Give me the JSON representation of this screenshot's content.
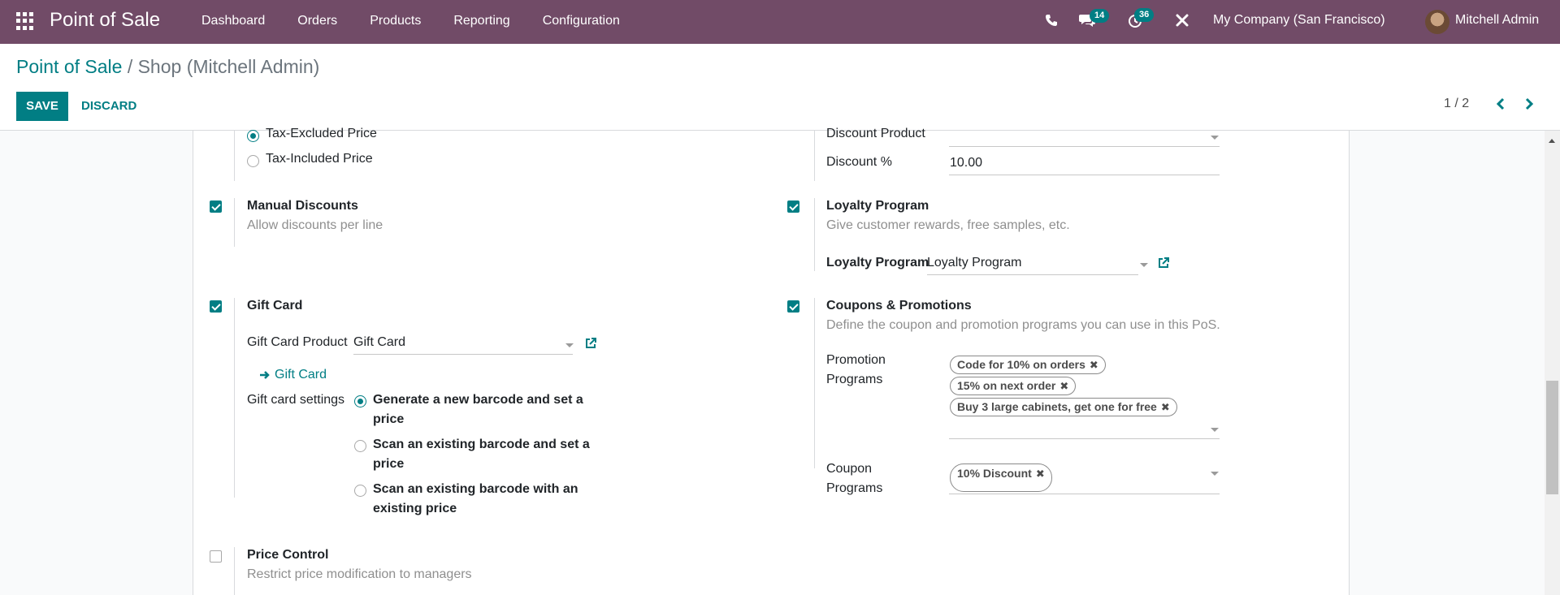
{
  "navbar": {
    "brand": "Point of Sale",
    "menu": [
      "Dashboard",
      "Orders",
      "Products",
      "Reporting",
      "Configuration"
    ],
    "messages_badge": "14",
    "activities_badge": "36",
    "company": "My Company (San Francisco)",
    "user": "Mitchell Admin"
  },
  "control": {
    "breadcrumb_root": "Point of Sale",
    "breadcrumb_sep": "/",
    "breadcrumb_current": "Shop (Mitchell Admin)",
    "save": "SAVE",
    "discard": "DISCARD",
    "pager": "1 / 2"
  },
  "left": {
    "tax_excluded": "Tax-Excluded Price",
    "tax_included": "Tax-Included Price",
    "manual_discounts": {
      "title": "Manual Discounts",
      "desc": "Allow discounts per line",
      "checked": true
    },
    "gift_card": {
      "title": "Gift Card",
      "checked": true,
      "product_label": "Gift Card Product",
      "product_value": "Gift Card",
      "link": "Gift Card",
      "settings_label": "Gift card settings",
      "options": [
        {
          "line1": "Generate a new barcode and set a",
          "line2": "price",
          "checked": true
        },
        {
          "line1": "Scan an existing barcode and set a",
          "line2": "price",
          "checked": false
        },
        {
          "line1": "Scan an existing barcode with an",
          "line2": "existing price",
          "checked": false
        }
      ]
    },
    "price_control": {
      "title": "Price Control",
      "desc": "Restrict price modification to managers",
      "checked": false
    }
  },
  "right": {
    "discount_product_label": "Discount Product",
    "discount_pct_label": "Discount %",
    "discount_pct_value": "10.00",
    "loyalty": {
      "title": "Loyalty Program",
      "desc": "Give customer rewards, free samples, etc.",
      "checked": true,
      "field_label": "Loyalty Program",
      "field_value": "Loyalty Program"
    },
    "coupons": {
      "title": "Coupons & Promotions",
      "desc": "Define the coupon and promotion programs you can use in this PoS.",
      "checked": true,
      "promo_label_1": "Promotion",
      "promo_label_2": "Programs",
      "promo_tags": [
        "Code for 10% on orders",
        "15% on next order",
        "Buy 3 large cabinets, get one for free"
      ],
      "coupon_label_1": "Coupon",
      "coupon_label_2": "Programs",
      "coupon_tags": [
        "10% Discount"
      ]
    }
  },
  "colors": {
    "brand": "#714b67",
    "accent": "#017e84"
  }
}
